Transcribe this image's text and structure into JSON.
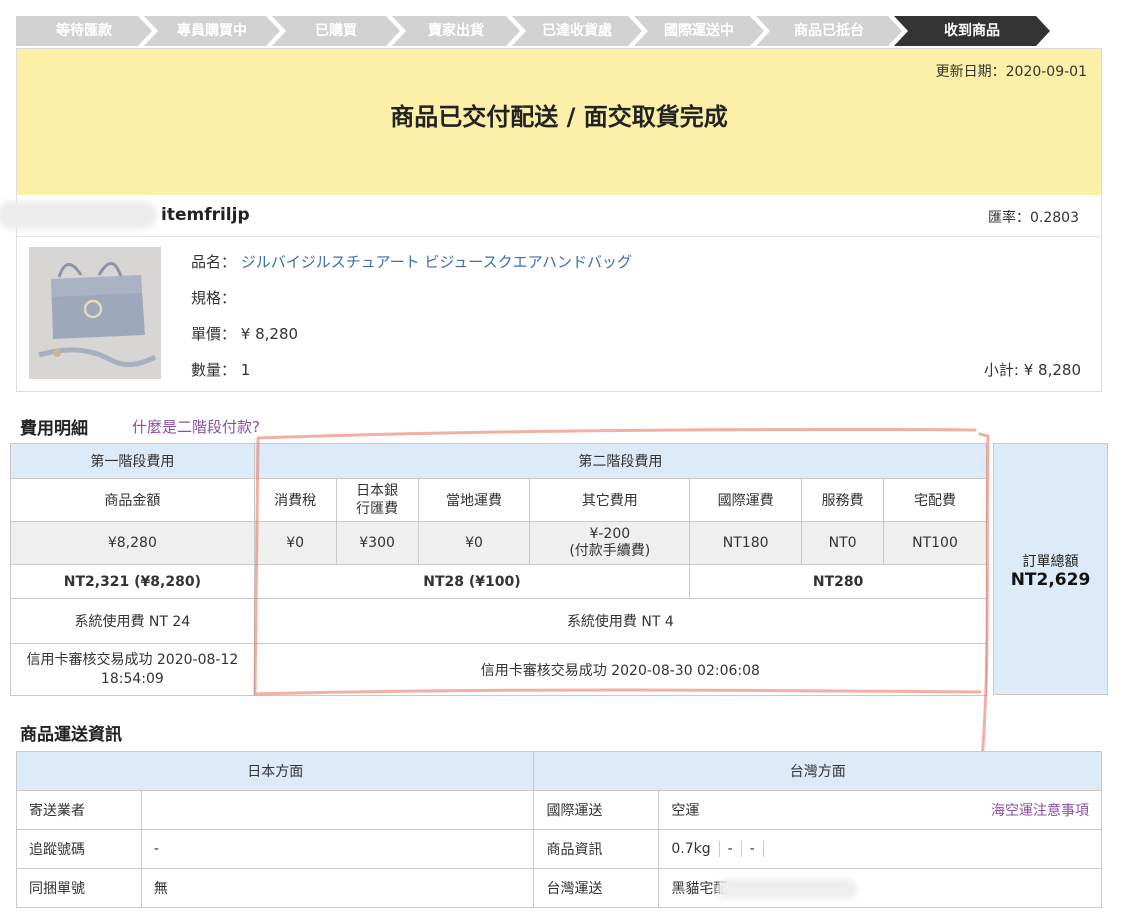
{
  "steps": [
    "等待匯款",
    "專員購買中",
    "已購買",
    "賣家出貨",
    "已達收貨處",
    "國際運送中",
    "商品已抵台",
    "收到商品"
  ],
  "active_step": 7,
  "order": {
    "update_date": "更新日期：2020-09-01",
    "status_title": "商品已交付配送 / 面交取貨完成",
    "seller": "itemfriljp",
    "rate": "匯率：0.2803",
    "item_name_label": "品名：",
    "item_name": "ジルバイジルスチュアート ビジュースクエアハンドバッグ",
    "spec_label": "規格：",
    "spec": "",
    "unit_price_label": "單價：",
    "unit_price": "¥ 8,280",
    "qty_label": "數量：",
    "qty": "1",
    "subtotal": "小計: ¥ 8,280"
  },
  "fees": {
    "title": "費用明細",
    "faq": "什麼是二階段付款?",
    "stage1": "第一階段費用",
    "stage2": "第二階段費用",
    "columns": [
      "商品金額",
      "消費稅",
      "日本銀\n行匯費",
      "當地運費",
      "其它費用",
      "國際運費",
      "服務費",
      "宅配費"
    ],
    "values": [
      "¥8,280",
      "¥0",
      "¥300",
      "¥0",
      "¥-200",
      "NT180",
      "NT0",
      "NT100"
    ],
    "other_fee_note": "(付款手續費)",
    "stage1_total": "NT2,321 (¥8,280)",
    "stage2_yen_total": "NT28 (¥100)",
    "stage2_nt_total": "NT280",
    "sys_fee1": "系統使用費 NT 24",
    "sys_fee2": "系統使用費 NT 4",
    "pay1": "信用卡審核交易成功 2020-08-12 18:54:09",
    "pay2": "信用卡審核交易成功 2020-08-30 02:06:08",
    "order_total_label": "訂單總額",
    "order_total": "NT2,629"
  },
  "shipping": {
    "title": "商品運送資訊",
    "jp_header": "日本方面",
    "tw_header": "台灣方面",
    "rows": [
      {
        "jp_label": "寄送業者",
        "jp_value": "",
        "tw_label": "國際運送",
        "tw_value": "空運"
      },
      {
        "jp_label": "追蹤號碼",
        "jp_value": "-",
        "tw_label": "商品資訊",
        "tw_value": "0.7kg"
      },
      {
        "jp_label": "同捆單號",
        "jp_value": "無",
        "tw_label": "台灣運送",
        "tw_value": "黑貓宅配"
      }
    ],
    "notice_link": "海空運注意事項",
    "item_info_extra": [
      "-",
      "-"
    ]
  },
  "colors": {
    "banner": "#fcf0a8",
    "active_step": "#333333",
    "inactive_step": "#d2d2d2",
    "link": "#3c6eb4",
    "header_blue": "#ddeaf8",
    "annotation": "#e8705a"
  }
}
